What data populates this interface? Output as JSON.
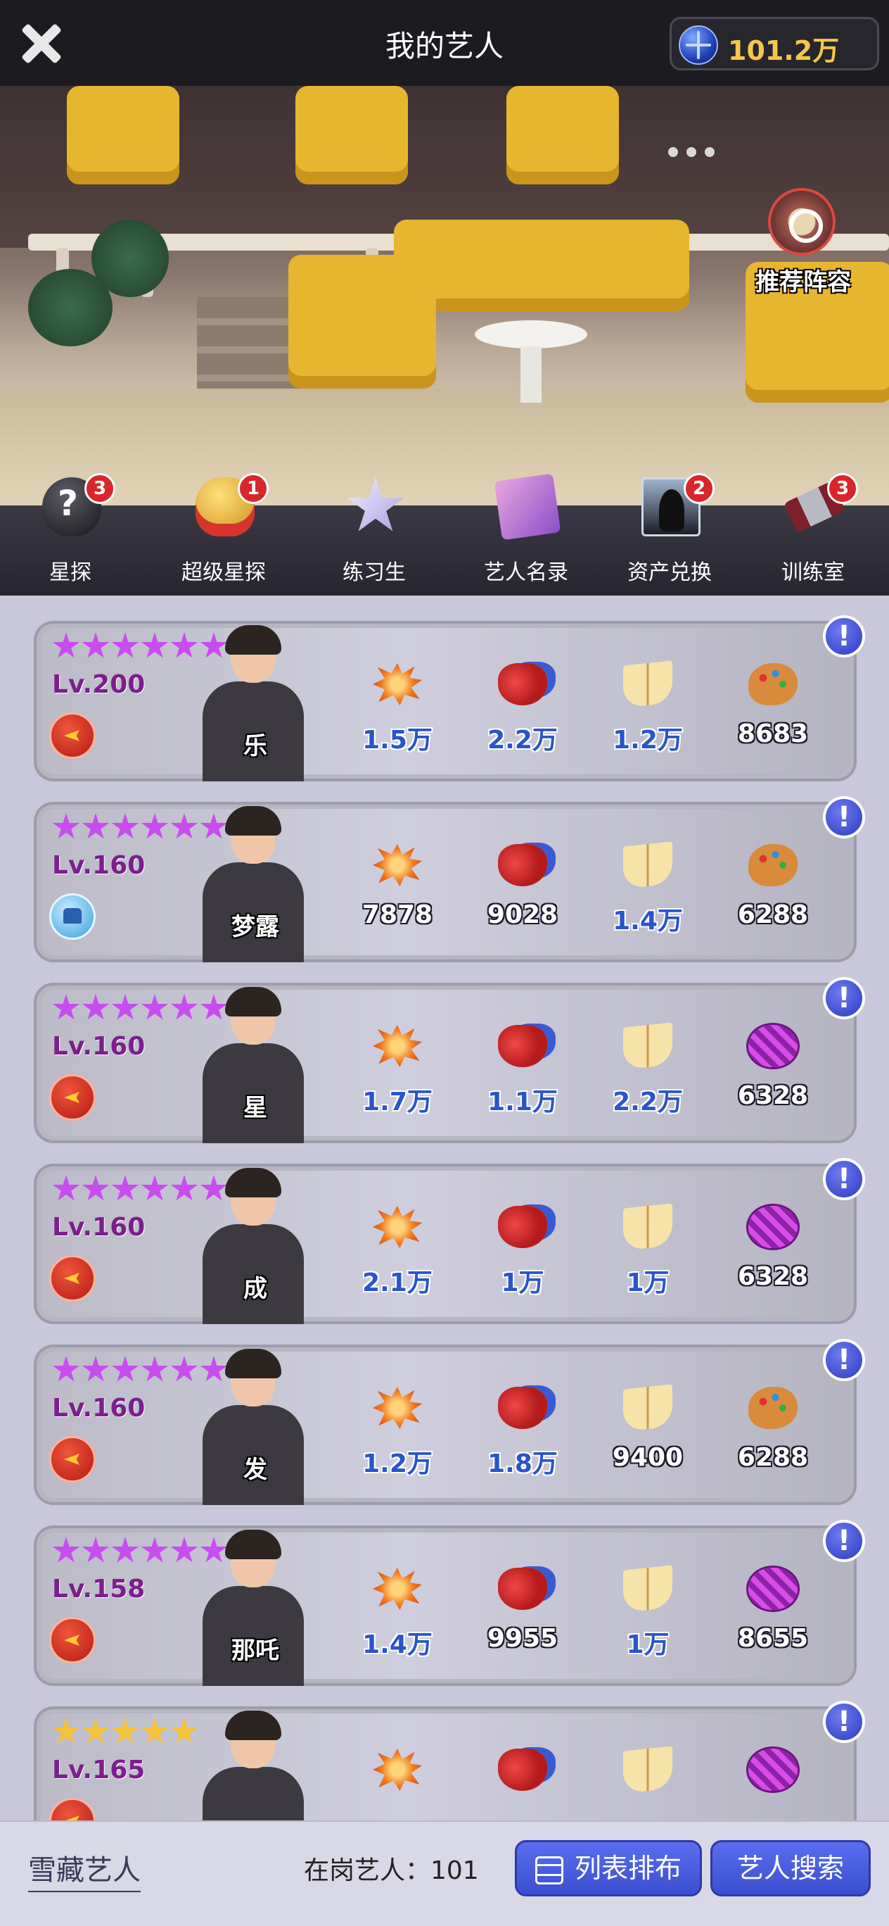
{
  "header": {
    "title": "我的艺人",
    "currency": "101.2万"
  },
  "scene": {
    "recommend_label": "推荐阵容"
  },
  "nav": [
    {
      "label": "星探",
      "badge": "3",
      "icon": "scout-hat-icon"
    },
    {
      "label": "超级星探",
      "badge": "1",
      "icon": "super-scout-hat-icon"
    },
    {
      "label": "练习生",
      "badge": "",
      "icon": "trainee-star-icon"
    },
    {
      "label": "艺人名录",
      "badge": "",
      "icon": "directory-book-icon"
    },
    {
      "label": "资产兑换",
      "badge": "2",
      "icon": "asset-exchange-icon"
    },
    {
      "label": "训练室",
      "badge": "3",
      "icon": "dumbbell-icon"
    }
  ],
  "artists": [
    {
      "name": "乐",
      "level": "Lv.200",
      "stars": 6,
      "star_color": "purple",
      "flag": "red",
      "stats": [
        "1.5万",
        "2.2万",
        "1.2万",
        "8683"
      ],
      "hi": [
        true,
        true,
        true,
        false
      ],
      "fourth_icon": "palette"
    },
    {
      "name": "梦露",
      "level": "Lv.160",
      "stars": 6,
      "star_color": "purple",
      "flag": "blue",
      "stats": [
        "7878",
        "9028",
        "1.4万",
        "6288"
      ],
      "hi": [
        false,
        false,
        true,
        false
      ],
      "fourth_icon": "palette"
    },
    {
      "name": "星",
      "level": "Lv.160",
      "stars": 6,
      "star_color": "purple",
      "flag": "red",
      "stats": [
        "1.7万",
        "1.1万",
        "2.2万",
        "6328"
      ],
      "hi": [
        true,
        true,
        true,
        false
      ],
      "fourth_icon": "disco"
    },
    {
      "name": "成",
      "level": "Lv.160",
      "stars": 6,
      "star_color": "purple",
      "flag": "red",
      "stats": [
        "2.1万",
        "1万",
        "1万",
        "6328"
      ],
      "hi": [
        true,
        true,
        true,
        false
      ],
      "fourth_icon": "disco"
    },
    {
      "name": "发",
      "level": "Lv.160",
      "stars": 6,
      "star_color": "purple",
      "flag": "red",
      "stats": [
        "1.2万",
        "1.8万",
        "9400",
        "6288"
      ],
      "hi": [
        true,
        true,
        false,
        false
      ],
      "fourth_icon": "palette"
    },
    {
      "name": "那吒",
      "level": "Lv.158",
      "stars": 6,
      "star_color": "purple",
      "flag": "red",
      "stats": [
        "1.4万",
        "9955",
        "1万",
        "8655"
      ],
      "hi": [
        true,
        false,
        true,
        false
      ],
      "fourth_icon": "disco"
    },
    {
      "name": "",
      "level": "Lv.165",
      "stars": 5,
      "star_color": "gold",
      "flag": "red",
      "stats": [
        "",
        "",
        "",
        ""
      ],
      "hi": [
        false,
        false,
        false,
        false
      ],
      "fourth_icon": "disco"
    }
  ],
  "footer": {
    "collection_link": "雪藏艺人",
    "active_count": "在岗艺人：101",
    "sort_button": "列表排布",
    "search_button": "艺人搜索"
  },
  "colors": {
    "accent_button": "#4a5fe0",
    "star_purple": "#c94cf0",
    "star_gold": "#f4c13a",
    "currency_text": "#f5c64a"
  }
}
